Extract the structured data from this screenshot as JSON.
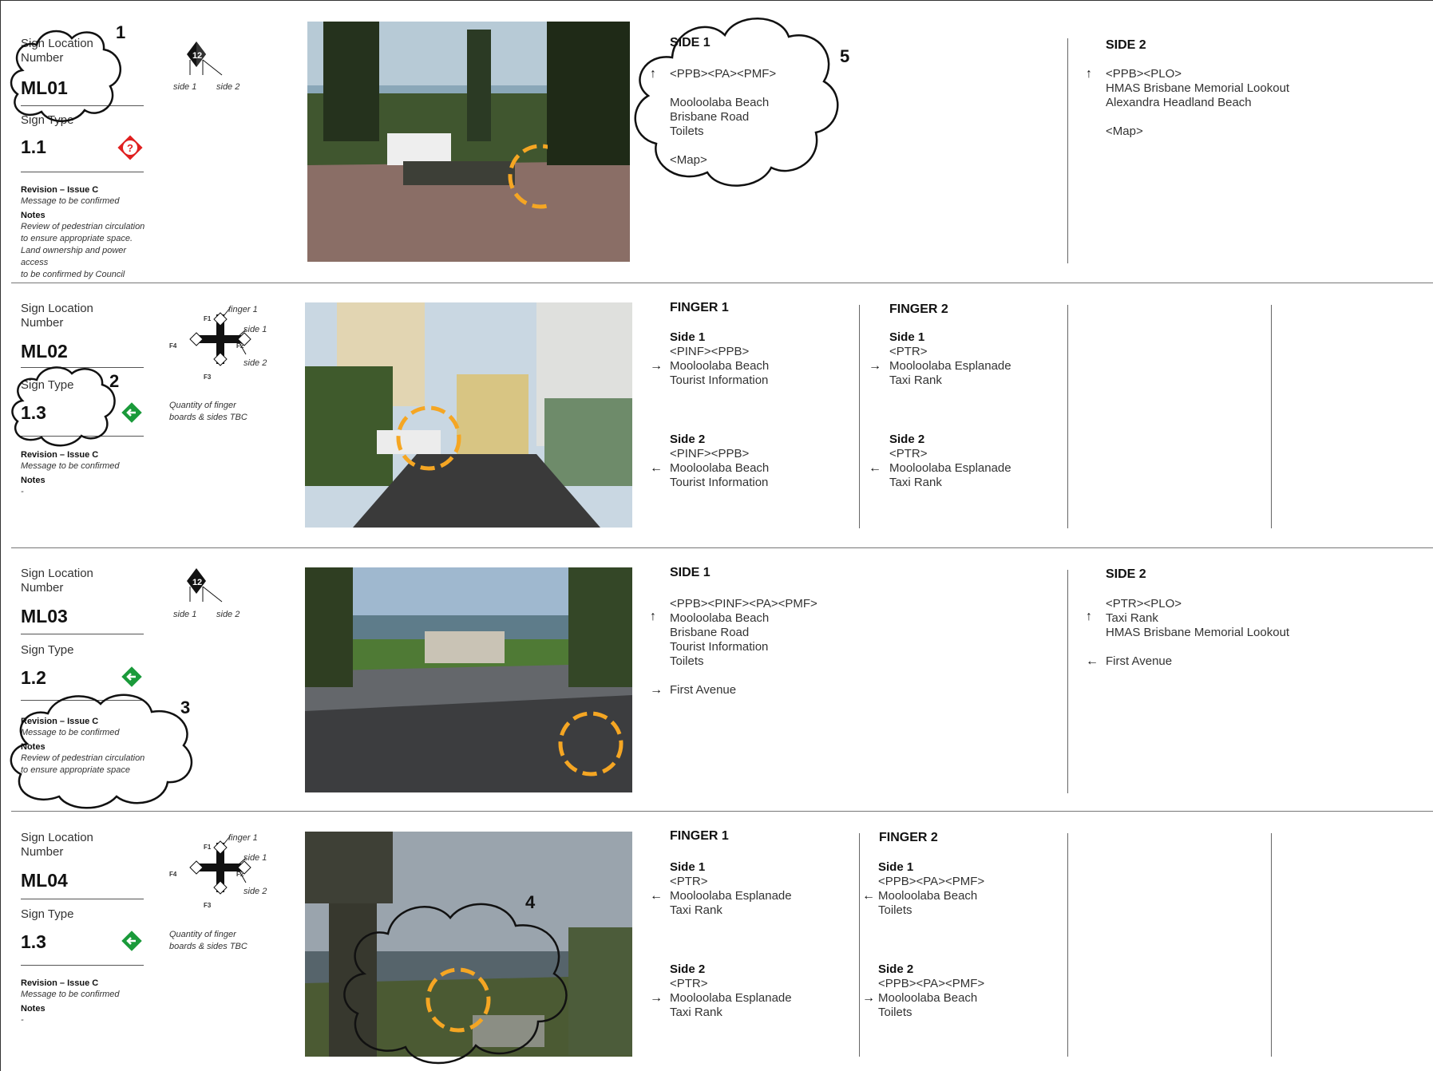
{
  "labels": {
    "sign_location": [
      "Sign Location",
      "Number"
    ],
    "sign_type": "Sign Type",
    "notes": "Notes",
    "side_1": "side 1",
    "side_2": "side 2",
    "finger_1": "finger 1",
    "f1": "F1",
    "f2": "F2",
    "f3": "F3",
    "f4": "F4",
    "qty_note": [
      "Quantity of finger",
      "boards & sides TBC"
    ]
  },
  "clouds": {
    "c1": "1",
    "c2": "2",
    "c3": "3",
    "c4": "4",
    "c5": "5"
  },
  "rows": [
    {
      "code": "ML01",
      "type": "1.1",
      "type_icon": "question-diamond-icon",
      "revision": "Revision – Issue C",
      "message": "Message to be confirmed",
      "notes": [
        "Review of pedestrian circulation",
        "to ensure appropriate space.",
        "Land ownership and power access",
        "to be confirmed by Council"
      ],
      "side1": {
        "title": "SIDE 1",
        "lines": [
          "<PPB><PA><PMF>",
          "",
          "Mooloolaba Beach",
          "Brisbane Road",
          "Toilets",
          "",
          "<Map>"
        ]
      },
      "side2": {
        "title": "SIDE 2",
        "lines": [
          "<PPB><PLO>",
          "HMAS Brisbane Memorial Lookout",
          "Alexandra Headland Beach",
          "",
          "<Map>"
        ]
      }
    },
    {
      "code": "ML02",
      "type": "1.3",
      "type_icon": "left-arrow-diamond-icon",
      "revision": "Revision – Issue C",
      "message": "Message to be confirmed",
      "notes": [
        "-"
      ],
      "finger1": {
        "title": "FINGER 1",
        "s1": {
          "h": "Side 1",
          "code": "<PINF><PPB>",
          "lines": [
            "Mooloolaba Beach",
            "Tourist Information"
          ]
        },
        "s2": {
          "h": "Side 2",
          "code": "<PINF><PPB>",
          "lines": [
            "Mooloolaba Beach",
            "Tourist Information"
          ]
        }
      },
      "finger2": {
        "title": "FINGER 2",
        "s1": {
          "h": "Side 1",
          "code": "<PTR>",
          "lines": [
            "Mooloolaba Esplanade",
            "Taxi Rank"
          ]
        },
        "s2": {
          "h": "Side 2",
          "code": "<PTR>",
          "lines": [
            "Mooloolaba Esplanade",
            "Taxi Rank"
          ]
        }
      }
    },
    {
      "code": "ML03",
      "type": "1.2",
      "type_icon": "left-arrow-diamond-icon",
      "revision": "Revision – Issue C",
      "message": "Message to be confirmed",
      "notes": [
        "Review of pedestrian circulation",
        "to ensure appropriate space"
      ],
      "side1": {
        "title": "SIDE 1",
        "lines": [
          "<PPB><PINF><PA><PMF>",
          "Mooloolaba Beach",
          "Brisbane Road",
          "Tourist Information",
          "Toilets",
          "",
          "First Avenue"
        ]
      },
      "side2": {
        "title": "SIDE 2",
        "lines": [
          "<PTR><PLO>",
          "Taxi Rank",
          "HMAS Brisbane Memorial Lookout",
          "",
          "First Avenue"
        ]
      }
    },
    {
      "code": "ML04",
      "type": "1.3",
      "type_icon": "left-arrow-diamond-icon",
      "revision": "Revision – Issue C",
      "message": "Message to be confirmed",
      "notes": [
        "-"
      ],
      "finger1": {
        "title": "FINGER 1",
        "s1": {
          "h": "Side 1",
          "code": "<PTR>",
          "lines": [
            "Mooloolaba Esplanade",
            "Taxi Rank"
          ]
        },
        "s2": {
          "h": "Side 2",
          "code": "<PTR>",
          "lines": [
            "Mooloolaba Esplanade",
            "Taxi Rank"
          ]
        }
      },
      "finger2": {
        "title": "FINGER 2",
        "s1": {
          "h": "Side 1",
          "code": "<PPB><PA><PMF>",
          "lines": [
            "Mooloolaba Beach",
            "Toilets"
          ]
        },
        "s2": {
          "h": "Side 2",
          "code": "<PPB><PA><PMF>",
          "lines": [
            "Mooloolaba Beach",
            "Toilets"
          ]
        }
      }
    }
  ],
  "colors": {
    "marker": "#f5a623",
    "red_sign": "#e02020",
    "green_sign": "#1a9a3a"
  }
}
